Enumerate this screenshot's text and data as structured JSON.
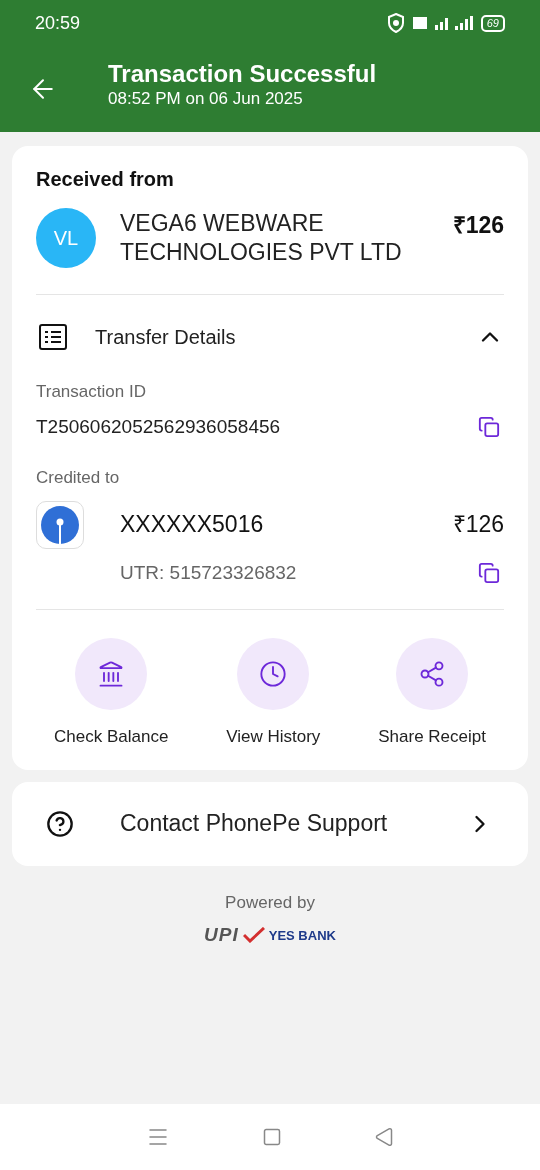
{
  "status_bar": {
    "time": "20:59",
    "battery": "69"
  },
  "header": {
    "title": "Transaction Successful",
    "subtitle": "08:52 PM on 06 Jun 2025"
  },
  "received": {
    "heading": "Received from",
    "avatar": "VL",
    "name": "VEGA6 WEBWARE TECHNOLOGIES PVT LTD",
    "amount": "₹126"
  },
  "transfer_details": {
    "title": "Transfer Details",
    "expanded": true,
    "transaction_id_label": "Transaction ID",
    "transaction_id": "T2506062052562936058456",
    "credited_label": "Credited to",
    "account": "XXXXXX5016",
    "amount": "₹126",
    "utr": "UTR: 515723326832"
  },
  "actions": [
    {
      "kind": "bank",
      "label": "Check Balance"
    },
    {
      "kind": "clock",
      "label": "View History"
    },
    {
      "kind": "share",
      "label": "Share Receipt"
    }
  ],
  "support": {
    "label": "Contact PhonePe Support"
  },
  "footer": {
    "powered": "Powered by",
    "upi": "UPI",
    "bank": "YES BANK"
  }
}
